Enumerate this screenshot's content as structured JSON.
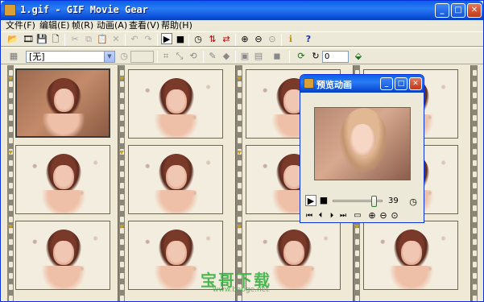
{
  "window": {
    "title": "1.gif - GIF Movie Gear",
    "controls": {
      "minimize": "_",
      "maximize": "□",
      "close": "✕"
    }
  },
  "menu": [
    {
      "label": "文件(F)"
    },
    {
      "label": "编辑(E)"
    },
    {
      "label": "帧(R)"
    },
    {
      "label": "动画(A)"
    },
    {
      "label": "查看(V)"
    },
    {
      "label": "帮助(H)"
    }
  ],
  "toolbar1": {
    "icons": [
      {
        "name": "open-icon",
        "glyph": "📂"
      },
      {
        "name": "film-icon",
        "glyph": "🎞"
      },
      {
        "name": "save-icon",
        "glyph": "💾"
      },
      {
        "name": "new-icon",
        "glyph": "🗋"
      },
      {
        "name": "cut-icon",
        "glyph": "✂"
      },
      {
        "name": "copy-icon",
        "glyph": "⧉"
      },
      {
        "name": "paste-icon",
        "glyph": "📋"
      },
      {
        "name": "delete-icon",
        "glyph": "✕"
      },
      {
        "name": "undo-icon",
        "glyph": "↶"
      },
      {
        "name": "redo-icon",
        "glyph": "↷"
      },
      {
        "name": "play-icon",
        "glyph": "▶"
      },
      {
        "name": "stop-icon",
        "glyph": "■"
      },
      {
        "name": "timer-icon",
        "glyph": "◷"
      },
      {
        "name": "flip-vertical-icon",
        "glyph": "⇅"
      },
      {
        "name": "flip-horizontal-icon",
        "glyph": "⇄"
      },
      {
        "name": "zoom-in-icon",
        "glyph": "⊕"
      },
      {
        "name": "zoom-out-icon",
        "glyph": "⊖"
      },
      {
        "name": "zoom-actual-icon",
        "glyph": "⊙"
      },
      {
        "name": "info-icon",
        "glyph": "ℹ"
      },
      {
        "name": "help-icon",
        "glyph": "?"
      }
    ]
  },
  "toolbar2": {
    "combo_value": "[无]",
    "number_value": "0",
    "icons": [
      {
        "name": "properties-icon",
        "glyph": "▦"
      },
      {
        "name": "clock-icon",
        "glyph": "◷"
      },
      {
        "name": "crop-icon",
        "glyph": "⌗"
      },
      {
        "name": "resize-icon",
        "glyph": "⤡"
      },
      {
        "name": "rotate-icon",
        "glyph": "⟲"
      },
      {
        "name": "brush-icon",
        "glyph": "✎"
      },
      {
        "name": "fill-icon",
        "glyph": "◆"
      },
      {
        "name": "frame-icon",
        "glyph": "▣"
      },
      {
        "name": "frames-icon",
        "glyph": "▤"
      },
      {
        "name": "palette-icon",
        "glyph": "◼"
      },
      {
        "name": "loop-icon",
        "glyph": "⟳"
      },
      {
        "name": "refresh-icon",
        "glyph": "↻"
      },
      {
        "name": "optimize-icon",
        "glyph": "⬙"
      }
    ]
  },
  "preview": {
    "title": "预览动画",
    "frame_number": "39",
    "slider_position": 0.85,
    "controls": [
      {
        "name": "play-icon",
        "glyph": "▶"
      },
      {
        "name": "stop-icon",
        "glyph": "■"
      }
    ],
    "nav": [
      {
        "name": "first-frame-icon",
        "glyph": "⏮"
      },
      {
        "name": "prev-frame-icon",
        "glyph": "⏴"
      },
      {
        "name": "next-frame-icon",
        "glyph": "⏵"
      },
      {
        "name": "last-frame-icon",
        "glyph": "⏭"
      },
      {
        "name": "screen-icon",
        "glyph": "▭"
      },
      {
        "name": "zoom-in-icon",
        "glyph": "⊕"
      },
      {
        "name": "zoom-out-icon",
        "glyph": "⊖"
      },
      {
        "name": "zoom-fit-icon",
        "glyph": "⊙"
      }
    ],
    "timer_glyph": "◷"
  },
  "frames": {
    "count": 16
  },
  "watermark": {
    "text": "宝哥下载",
    "sub": "www.baoge.net"
  }
}
